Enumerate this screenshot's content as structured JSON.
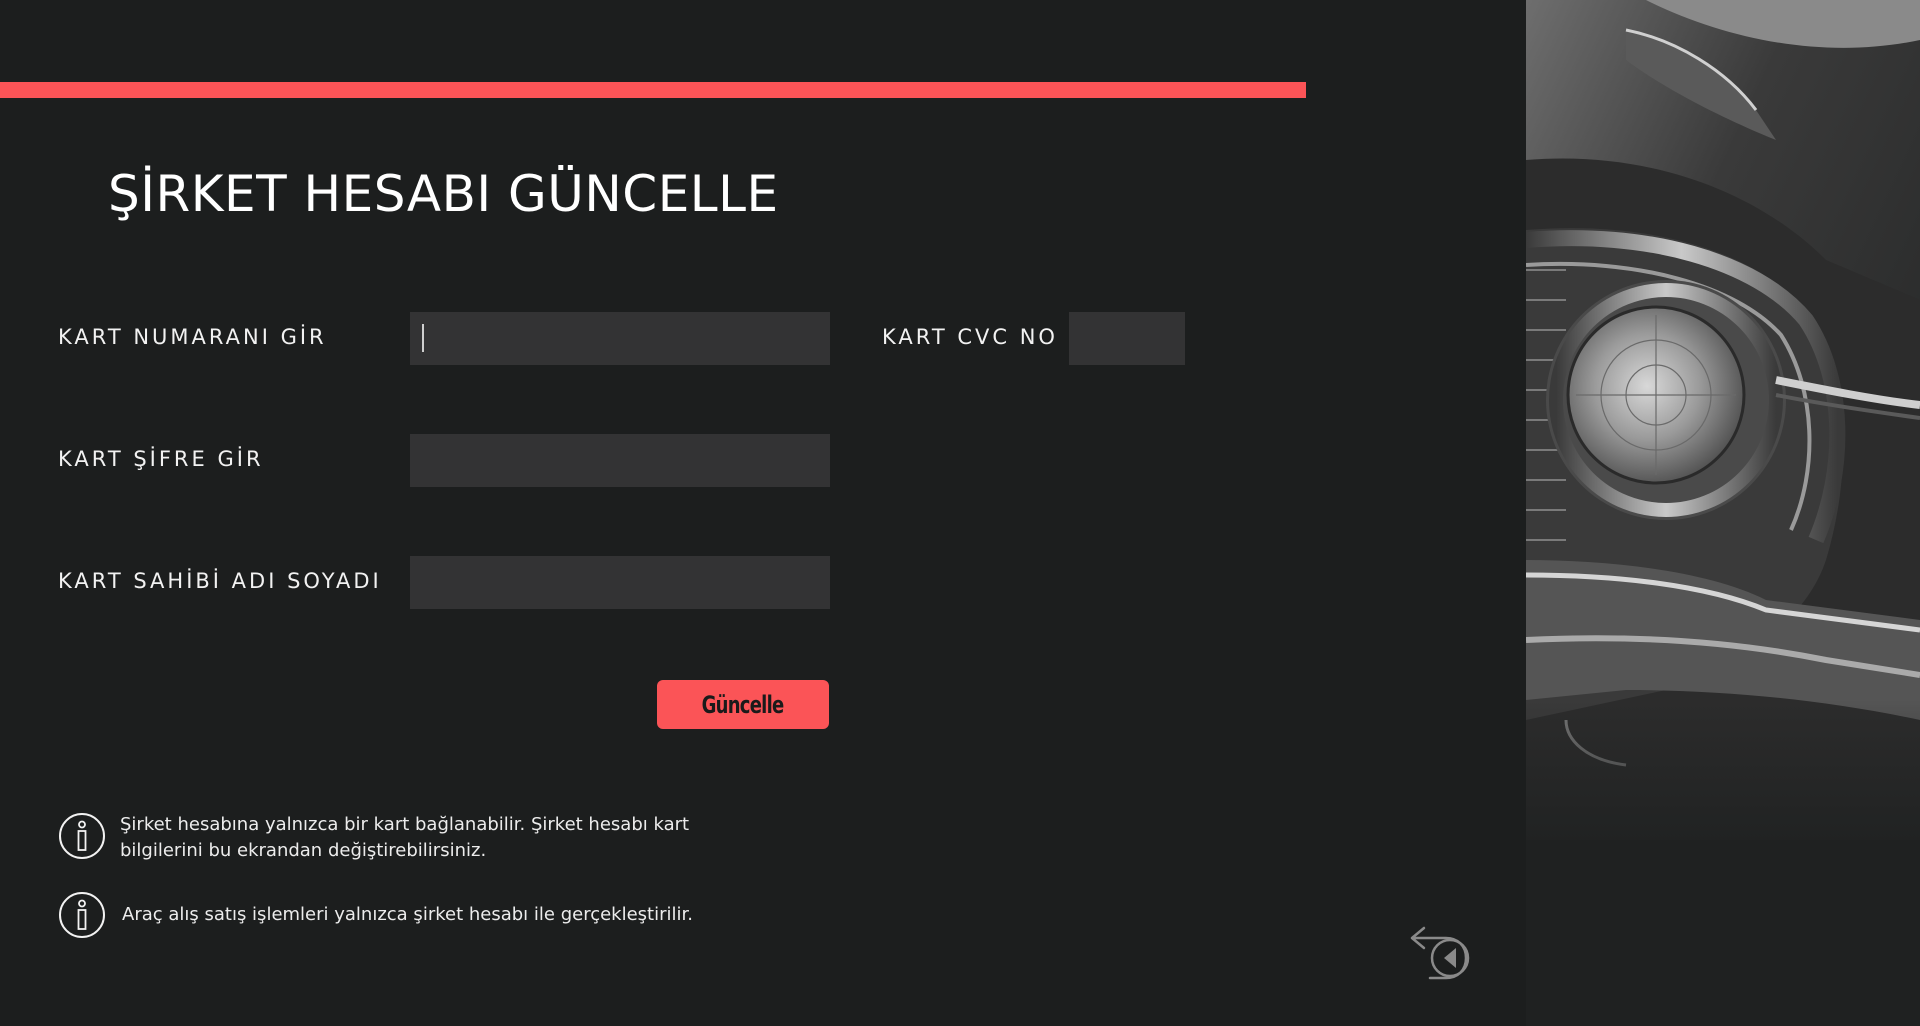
{
  "page": {
    "title": "ŞİRKET HESABI GÜNCELLE"
  },
  "form": {
    "card_number_label": "KART NUMARANI GİR",
    "card_number_value": "",
    "cvc_label": "KART CVC NO",
    "cvc_value": "",
    "password_label": "KART ŞİFRE GİR",
    "password_value": "",
    "holder_name_label": "KART SAHİBİ ADI SOYADI",
    "holder_name_value": "",
    "submit_label": "Güncelle"
  },
  "notes": [
    {
      "icon": "info-icon",
      "text": "Şirket hesabına yalnızca bir kart bağlanabilir. Şirket hesabı kart bilgilerini bu ekrandan değiştirebilirsiniz."
    },
    {
      "icon": "info-icon",
      "text": "Araç alış satış işlemleri yalnızca şirket hesabı ile gerçekleştirilir."
    }
  ],
  "navigation": {
    "back_icon": "back-arrow-icon"
  },
  "decor": {
    "photo": "vintage-car-headlight-photo"
  },
  "colors": {
    "background": "#1c1e1e",
    "accent": "#fb5457",
    "input_background": "#333334",
    "text": "#ffffff"
  }
}
